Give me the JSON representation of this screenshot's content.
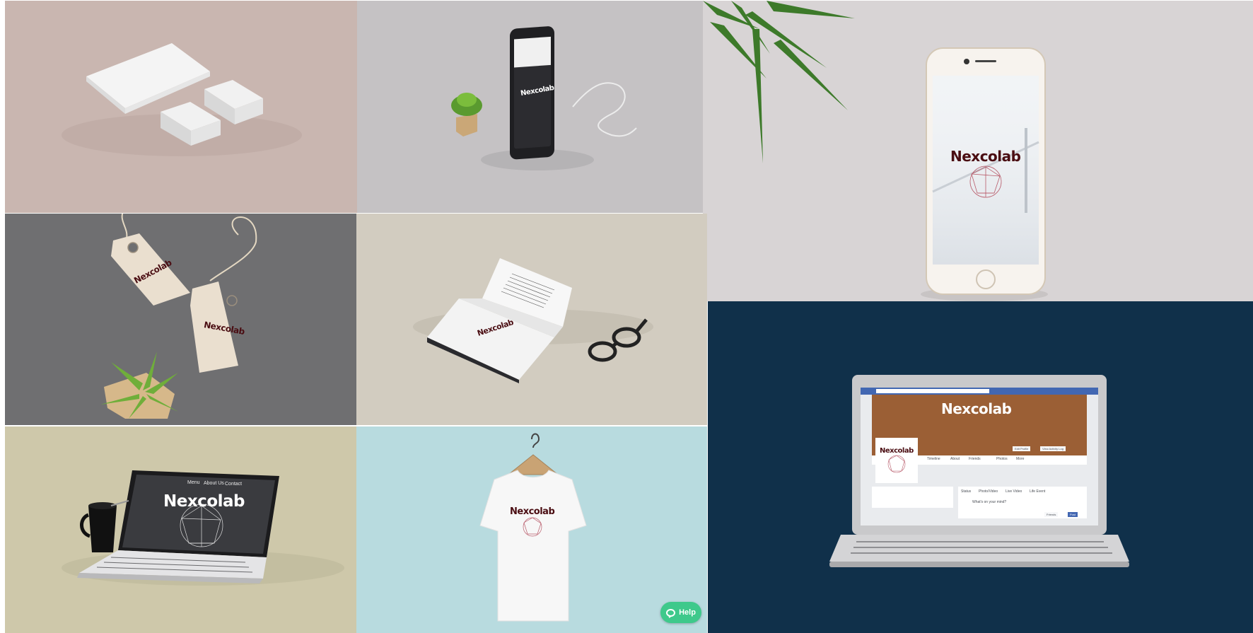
{
  "brand": {
    "name": "Nexcolab",
    "color": "#4a0d12"
  },
  "tiles": [
    {
      "id": "stationery",
      "background": "#c9b6b0"
    },
    {
      "id": "phone-earphones",
      "background": "#c5c2c4"
    },
    {
      "id": "iphone-fog",
      "background": "#d8d4d5"
    },
    {
      "id": "tags",
      "background": "#6f6f71"
    },
    {
      "id": "book-glasses",
      "background": "#d2ccc0"
    },
    {
      "id": "facebook-laptop",
      "background": "#10304a"
    },
    {
      "id": "laptop-mug",
      "background": "#cec8aa"
    },
    {
      "id": "tshirt",
      "background": "#b8dbdf"
    }
  ],
  "laptop_site": {
    "menu": [
      "Menu",
      "About Us",
      "Contact"
    ]
  },
  "facebook": {
    "nav": [
      "Timeline",
      "About",
      "Friends",
      "Photos",
      "More"
    ],
    "actions": [
      "Edit Profile",
      "View Activity Log"
    ],
    "composer_tabs": [
      "Status",
      "Photo/Video",
      "Live Video",
      "Life Event"
    ],
    "composer_placeholder": "What's on your mind?",
    "post_button": "Post",
    "audience_button": "Friends"
  },
  "help_button": {
    "label": "Help",
    "color": "#3ec98b"
  }
}
